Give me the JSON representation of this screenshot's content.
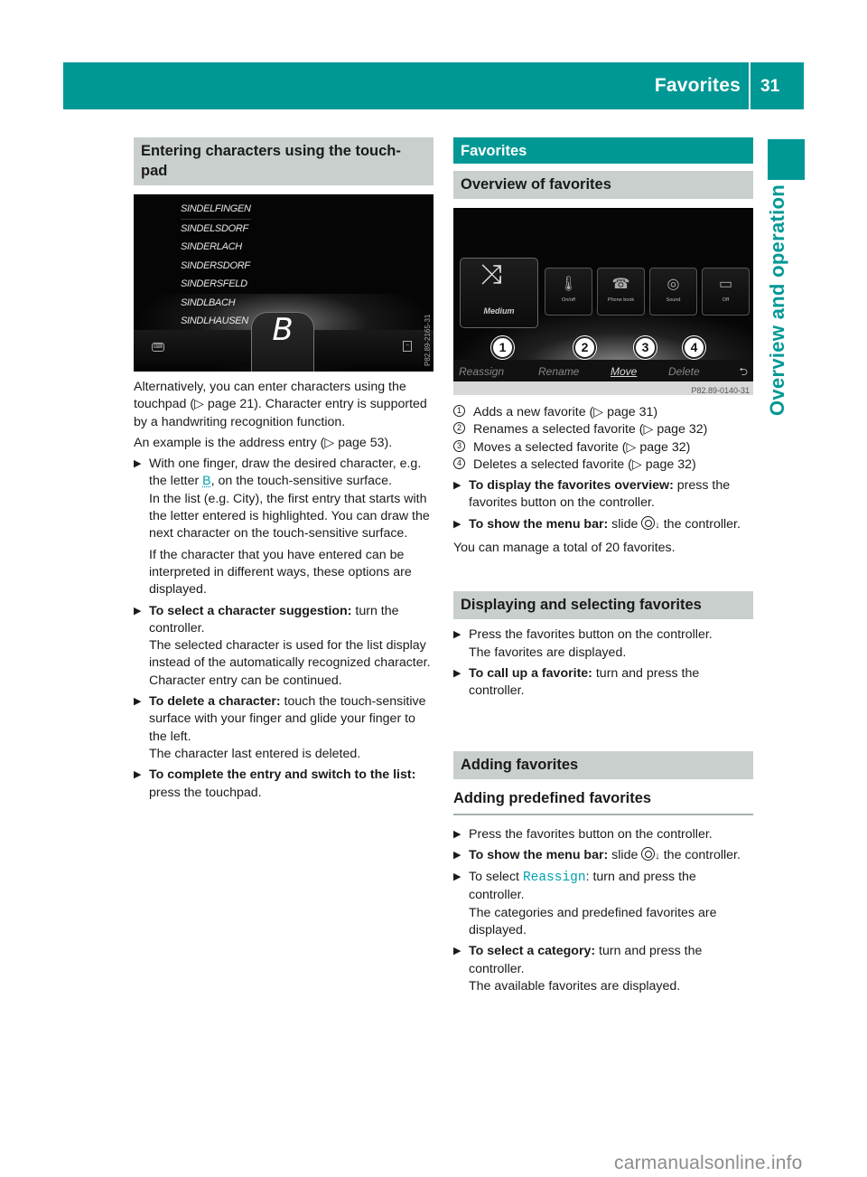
{
  "header": {
    "section_title": "Favorites",
    "page_number": "31"
  },
  "side_tab": {
    "label": "Overview and operation"
  },
  "left_column": {
    "heading": "Entering characters using the touch-pad",
    "heading_line1": "Entering characters using the touch-",
    "heading_line2": "pad",
    "screenshot": {
      "list_items": [
        "SINDELFINGEN",
        "SINDELSDORF",
        "SINDERLACH",
        "SINDERSDORF",
        "SINDERSFELD",
        "SINDLBACH",
        "SINDLHAUSEN"
      ],
      "pad_letter": "B",
      "left_icon": "keyboard-icon",
      "right_icon": "delete-icon",
      "code": "P82.89-2165-31"
    },
    "intro": "Alternatively, you can enter characters using the touchpad (▷ page 21). Character entry is supported by a handwriting recognition function.",
    "example": "An example is the address entry (▷ page 53).",
    "bullets": [
      {
        "pre": "With one finger, draw the desired character, e.g. the letter ",
        "highlight": "B",
        "post": ", on the touch-sensitive surface.",
        "result1": "In the list (e.g. City), the first entry that starts with the letter entered is highlighted. You can draw the next character on the touch-sensitive surface.",
        "result2": "If the character that you have entered can be interpreted in different ways, these options are displayed."
      },
      {
        "bold": "To select a character suggestion:",
        "text": " turn the controller.",
        "result": "The selected character is used for the list display instead of the automatically recognized character. Character entry can be continued."
      },
      {
        "bold": "To delete a character:",
        "text": " touch the touch-sensitive surface with your finger and glide your finger to the left.",
        "result": "The character last entered is deleted."
      },
      {
        "bold": "To complete the entry and switch to the list:",
        "text": " press the touchpad."
      }
    ]
  },
  "right_column": {
    "chapter": "Favorites",
    "overview": {
      "heading": "Overview of favorites",
      "screenshot": {
        "main_tile": "Medium",
        "tiles": [
          "On/off",
          "Phone book",
          "Sound",
          "Off"
        ],
        "markers": [
          "1",
          "2",
          "3",
          "4"
        ],
        "menu": [
          "Reassign",
          "Rename",
          "Move",
          "Delete"
        ],
        "active_menu": "Move",
        "back_icon": "back-icon",
        "code": "P82.89-0140-31"
      },
      "legend": [
        {
          "num": "1",
          "text": "Adds a new favorite (▷ page 31)"
        },
        {
          "num": "2",
          "text": "Renames a selected favorite (▷ page 32)"
        },
        {
          "num": "3",
          "text": "Moves a selected favorite (▷ page 32)"
        },
        {
          "num": "4",
          "text": "Deletes a selected favorite (▷ page 32)"
        }
      ],
      "bullets": [
        {
          "bold": "To display the favorites overview:",
          "text": " press the favorites button on the controller."
        },
        {
          "bold": "To show the menu bar:",
          "text_pre": " slide ",
          "text_post": " the controller."
        }
      ],
      "note": "You can manage a total of 20 favorites."
    },
    "displaying": {
      "heading": "Displaying and selecting favorites",
      "bullets": [
        {
          "text": "Press the favorites button on the controller.",
          "result": "The favorites are displayed."
        },
        {
          "bold": "To call up a favorite:",
          "text": " turn and press the controller."
        }
      ]
    },
    "adding": {
      "heading": "Adding favorites",
      "subheading": "Adding predefined favorites",
      "bullets": [
        {
          "text": "Press the favorites button on the controller."
        },
        {
          "bold": "To show the menu bar:",
          "text_pre": " slide ",
          "text_post": " the controller."
        },
        {
          "pre": "To select ",
          "code": "Reassign",
          "post": ": turn and press the controller.",
          "result": "The categories and predefined favorites are displayed."
        },
        {
          "bold": "To select a category:",
          "text": " turn and press the controller.",
          "result": "The available favorites are displayed."
        }
      ]
    }
  },
  "colors": {
    "brand_teal": "#009895",
    "section_grey": "#c8cfcd",
    "link_teal": "#009fb0"
  },
  "watermark": "carmanualsonline.info"
}
